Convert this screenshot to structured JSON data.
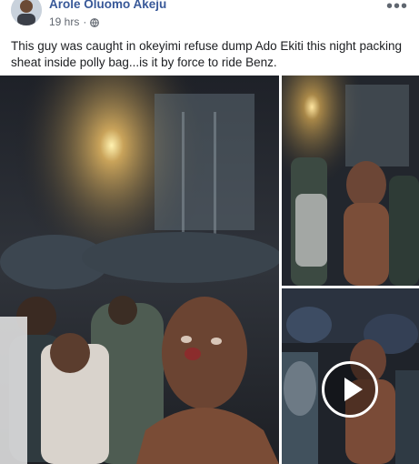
{
  "post": {
    "author": "Arole Oluomo Akeju",
    "timestamp": "19 hrs",
    "separator": "·",
    "privacy_icon": "globe-icon",
    "more_icon": "more-options-icon",
    "more_glyph": "•••",
    "caption": "This guy was caught in okeyimi refuse dump Ado Ekiti this night packing sheat inside polly bag...is it by force to ride Benz."
  },
  "media": {
    "photo_count": 3,
    "video_icon": "play-icon"
  },
  "colors": {
    "author_link": "#385898",
    "meta_text": "#616770",
    "body_text": "#1c1e21"
  }
}
